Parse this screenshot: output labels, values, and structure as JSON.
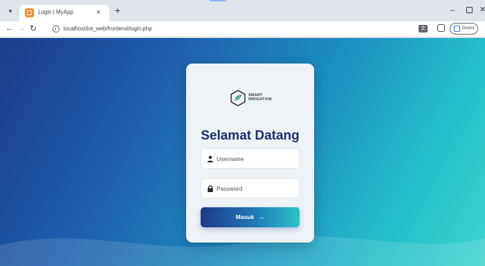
{
  "browser": {
    "tab_title": "Login | MyApp",
    "tab_close": "×",
    "new_tab": "+",
    "url": "localhost/iot_web/frontend/login.php",
    "profile_label": "Guest",
    "icons": [
      "tab-list-icon",
      "favicon",
      "close-icon",
      "new-tab-icon",
      "minimize-icon",
      "restore-icon",
      "window-close-icon",
      "back-arrow-icon",
      "forward-arrow-icon",
      "reload-icon",
      "site-info-icon",
      "translate-icon",
      "extension-icon",
      "profile-icon",
      "menu-dots-icon"
    ]
  },
  "login": {
    "logo_text_line1": "SMART",
    "logo_text_line2": "IRRIGATION",
    "heading": "Selamat Datang",
    "username_placeholder": "Username",
    "password_placeholder": "Password",
    "submit_label": "Masuk",
    "submit_arrow": "→",
    "icons": [
      "user-icon",
      "lock-icon",
      "leaf-logo-icon"
    ]
  },
  "colors": {
    "heading": "#1e2e6e",
    "gradient_start": "#1d3a8c",
    "gradient_end": "#3fd4d0",
    "card_bg": "#eef3f7"
  }
}
